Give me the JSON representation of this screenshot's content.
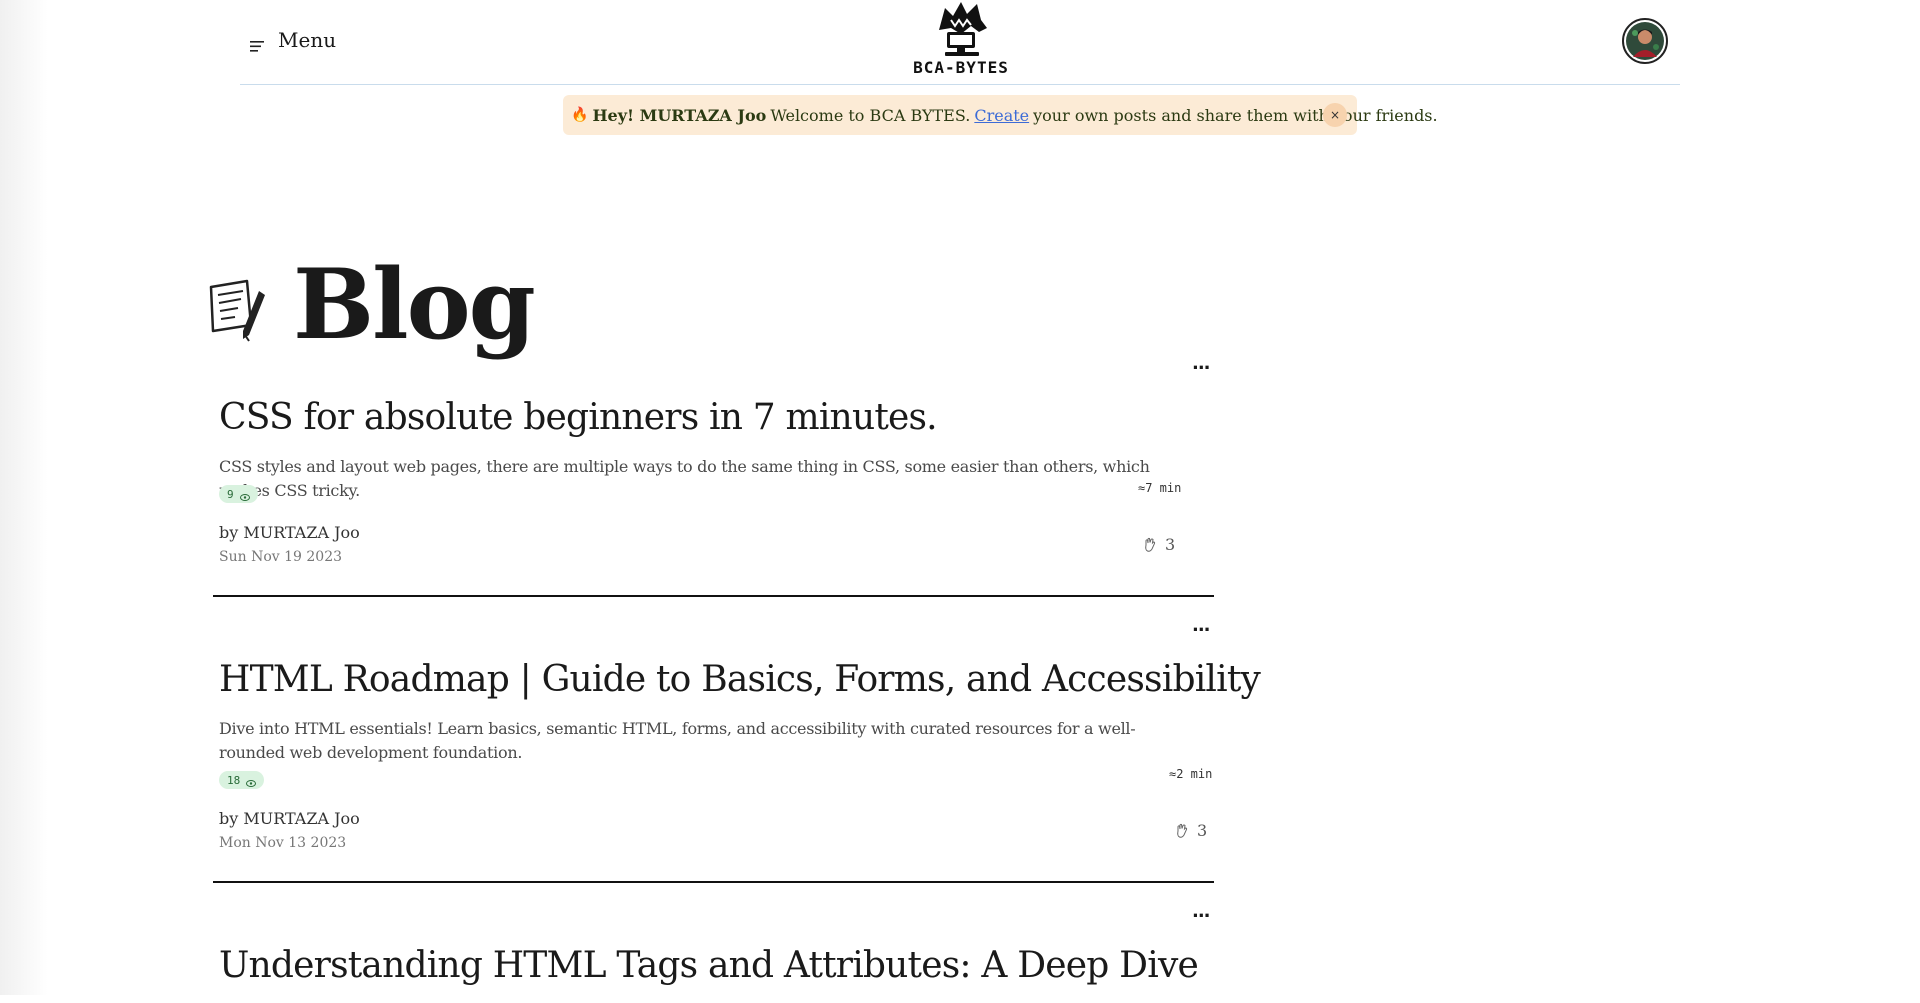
{
  "header": {
    "menu_label": "Menu",
    "logo_text": "BCA-BYTES",
    "menu_icon": "hamburger-icon",
    "avatar_icon": "user-avatar"
  },
  "banner": {
    "emoji": "🔥",
    "greeting": "Hey! MURTAZA Joo",
    "welcome": "Welcome to BCA BYTES.",
    "link_label": "Create",
    "rest": "your own posts and share them with your friends.",
    "close_label": "×",
    "bg_color": "#fcebd6"
  },
  "page": {
    "title": "Blog",
    "title_icon": "note-pen-icon"
  },
  "posts": [
    {
      "title": "CSS for absolute beginners in 7 minutes.",
      "description": "CSS styles and layout web pages, there are multiple ways to do the same thing in CSS, some easier than others, which makes CSS tricky.",
      "views": "9",
      "read_time": "≈7 min",
      "author": "by MURTAZA Joo",
      "date": "Sun Nov 19 2023",
      "claps": "3",
      "more_label": "..."
    },
    {
      "title": "HTML Roadmap | Guide to Basics, Forms, and Accessibility",
      "description": "Dive into HTML essentials! Learn basics, semantic HTML, forms, and accessibility with curated resources for a well-rounded web development foundation.",
      "views": "18",
      "read_time": "≈2 min",
      "author": "by MURTAZA Joo",
      "date": "Mon Nov 13 2023",
      "claps": "3",
      "more_label": "..."
    },
    {
      "title": "Understanding HTML Tags and Attributes: A Deep Dive",
      "more_label": "..."
    }
  ]
}
